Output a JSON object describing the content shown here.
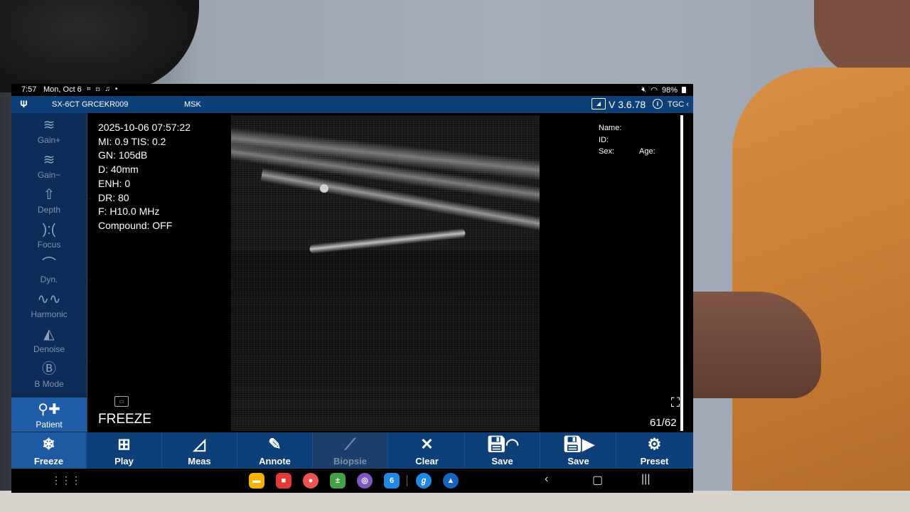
{
  "status_bar": {
    "time": "7:57",
    "date": "Mon, Oct 6",
    "notification_icons": "⌗ ⊡ ♫ •",
    "battery": "98%"
  },
  "app_bar": {
    "device": "SX-6CT GRCEKR009",
    "preset": "MSK",
    "version": "V 3.6.78",
    "tgc": "TGC ‹"
  },
  "left_toolbar": {
    "items": [
      {
        "label": "Gain+",
        "icon": "gain-plus-icon"
      },
      {
        "label": "Gain−",
        "icon": "gain-minus-icon"
      },
      {
        "label": "Depth",
        "icon": "depth-icon"
      },
      {
        "label": "Focus",
        "icon": "focus-icon"
      },
      {
        "label": "Dyn.",
        "icon": "dynamic-range-icon"
      },
      {
        "label": "Harmonic",
        "icon": "harmonic-icon"
      },
      {
        "label": "Denoise",
        "icon": "denoise-icon"
      },
      {
        "label": "B Mode",
        "icon": "b-mode-icon"
      },
      {
        "label": "Patient",
        "icon": "patient-icon"
      }
    ]
  },
  "image_info": {
    "timestamp": "2025-10-06 07:57:22",
    "mi_tis": "MI:  0.9  TIS:  0.2",
    "gain": "GN: 105dB",
    "depth": "D: 40mm",
    "enhance": "ENH: 0",
    "dynamic_range": "DR: 80",
    "frequency": "F: H10.0 MHz",
    "compound": "Compound:  OFF"
  },
  "freeze_state": "FREEZE",
  "patient": {
    "name_label": "Name:",
    "id_label": "ID:",
    "sex_label": "Sex:",
    "age_label": "Age:"
  },
  "frame_counter": "61/62",
  "bottom_toolbar": {
    "buttons": [
      {
        "label": "Freeze",
        "icon": "snowflake-icon"
      },
      {
        "label": "Play",
        "icon": "play-icon"
      },
      {
        "label": "Meas",
        "icon": "measure-icon"
      },
      {
        "label": "Annote",
        "icon": "annotate-icon"
      },
      {
        "label": "Biopsie",
        "icon": "biopsy-icon"
      },
      {
        "label": "Clear",
        "icon": "clear-icon"
      },
      {
        "label": "Save",
        "icon": "save-image-icon"
      },
      {
        "label": "Save",
        "icon": "save-video-icon"
      },
      {
        "label": "Preset",
        "icon": "gear-icon"
      }
    ]
  },
  "colors": {
    "toolbar_bg": "#0d3f78",
    "active": "#1f5ea6",
    "sidebar_bg": "#0a2a52"
  }
}
